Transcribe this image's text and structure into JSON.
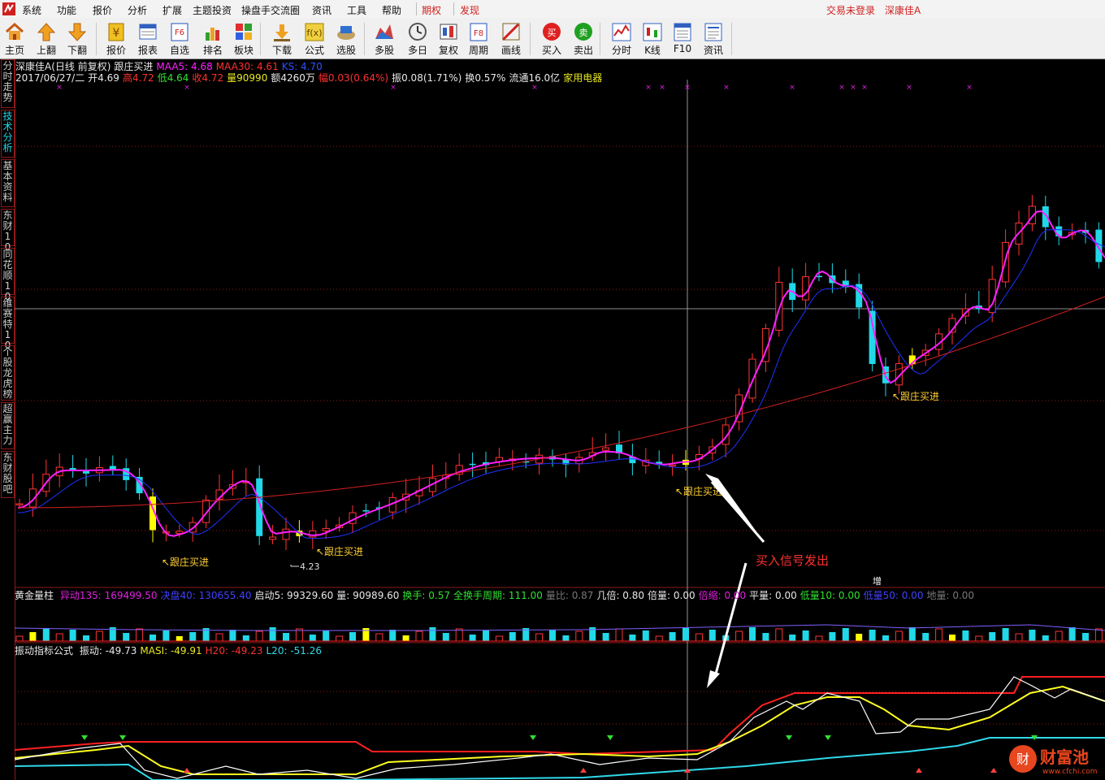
{
  "menu": {
    "items": [
      "系统",
      "功能",
      "报价",
      "分析",
      "扩展",
      "主题投资",
      "操盘手交流圈",
      "资讯",
      "工具",
      "帮助"
    ],
    "items_red": [
      "期权",
      "发现"
    ],
    "right": [
      "交易未登录",
      "深康佳A"
    ]
  },
  "toolbar": {
    "buttons": [
      {
        "label": "主页",
        "icon": "home-icon"
      },
      {
        "label": "上翻",
        "icon": "arrow-up-icon"
      },
      {
        "label": "下翻",
        "icon": "arrow-down-icon"
      },
      {
        "label": "报价",
        "icon": "quote-icon"
      },
      {
        "label": "报表",
        "icon": "report-icon"
      },
      {
        "label": "自选",
        "icon": "watchlist-icon"
      },
      {
        "label": "排名",
        "icon": "rank-icon"
      },
      {
        "label": "板块",
        "icon": "sector-icon"
      },
      {
        "label": "下载",
        "icon": "download-icon"
      },
      {
        "label": "公式",
        "icon": "formula-icon"
      },
      {
        "label": "选股",
        "icon": "stock-pick-icon"
      },
      {
        "label": "多股",
        "icon": "multi-stock-icon"
      },
      {
        "label": "多日",
        "icon": "multi-day-icon"
      },
      {
        "label": "复权",
        "icon": "adjust-icon"
      },
      {
        "label": "周期",
        "icon": "period-icon"
      },
      {
        "label": "画线",
        "icon": "draw-line-icon"
      },
      {
        "label": "买入",
        "icon": "buy-icon",
        "glyph": "买"
      },
      {
        "label": "卖出",
        "icon": "sell-icon",
        "glyph": "卖"
      },
      {
        "label": "分时",
        "icon": "intraday-icon"
      },
      {
        "label": "K线",
        "icon": "kline-icon"
      },
      {
        "label": "F10",
        "icon": "f10-icon"
      },
      {
        "label": "资讯",
        "icon": "news-icon"
      }
    ],
    "f6_text": "F6",
    "f8_text": "F8"
  },
  "sidebar": {
    "tabs": [
      "分时走势",
      "技术分析",
      "基本资料",
      "东财10",
      "同花顺10",
      "维赛特10",
      "个股龙虎榜",
      "超赢主力",
      "东财股吧"
    ],
    "active": 1
  },
  "header": {
    "line1": {
      "stock": "深康佳A",
      "mode": "(日线 前复权)",
      "indicator": "跟庄买进",
      "ma5": "MAA5: 4.68",
      "ma30": "MAA30: 4.61",
      "ks": "KS: 4.70"
    },
    "line2": {
      "date": "2017/06/27/二",
      "open": "开4.69",
      "high": "高4.72",
      "low": "低4.64",
      "close": "收4.72",
      "vol": "量90990",
      "amount": "额4260万",
      "range": "幅0.03(0.64%)",
      "amp": "振0.08(1.71%)",
      "turn": "换0.57%",
      "float": "流通16.0亿",
      "industry": "家用电器"
    }
  },
  "annotations": {
    "buy_tag": "跟庄买进",
    "low_mark": "4.23",
    "big_label": "买入信号发出",
    "zeng": "增"
  },
  "vol_panel": {
    "title": "黄金量柱",
    "items": [
      {
        "t": "异动135: 169499.50",
        "c": "#e020e0"
      },
      {
        "t": "决盘40: 130655.40",
        "c": "#4040ff"
      },
      {
        "t": "启动5: 99329.60",
        "c": "#e8e8e8"
      },
      {
        "t": "量: 90989.60",
        "c": "#e8e8e8"
      },
      {
        "t": "换手: 0.57",
        "c": "#30e030"
      },
      {
        "t": "全换手周期: 111.00",
        "c": "#30e030"
      },
      {
        "t": "量比: 0.87",
        "c": "#777777"
      },
      {
        "t": "几倍: 0.80",
        "c": "#e8e8e8"
      },
      {
        "t": "倍量: 0.00",
        "c": "#e8e8e8"
      },
      {
        "t": "倍缩: 0.00",
        "c": "#e020e0"
      },
      {
        "t": "平量: 0.00",
        "c": "#e8e8e8"
      },
      {
        "t": "低量10: 0.00",
        "c": "#30e030"
      },
      {
        "t": "低量50: 0.00",
        "c": "#4040ff"
      },
      {
        "t": "地量: 0.00",
        "c": "#777777"
      }
    ]
  },
  "osc_panel": {
    "title": "振动指标公式",
    "items": [
      {
        "t": "振动: -49.73",
        "c": "#e8e8e8"
      },
      {
        "t": "MASI: -49.91",
        "c": "#e8e820"
      },
      {
        "t": "H20: -49.23",
        "c": "#ff3030"
      },
      {
        "t": "L20: -51.26",
        "c": "#30d8e8"
      }
    ]
  },
  "watermark": {
    "brand": "财富池",
    "url": "www.cfchi.com",
    "glyph": "财"
  },
  "colors": {
    "up": "#ff3333",
    "down": "#21d8e8",
    "ma_fast": "#ff20ff",
    "ma_mid": "#2030ff",
    "ma_slow": "#d02020",
    "signal": "#ffff00"
  }
}
